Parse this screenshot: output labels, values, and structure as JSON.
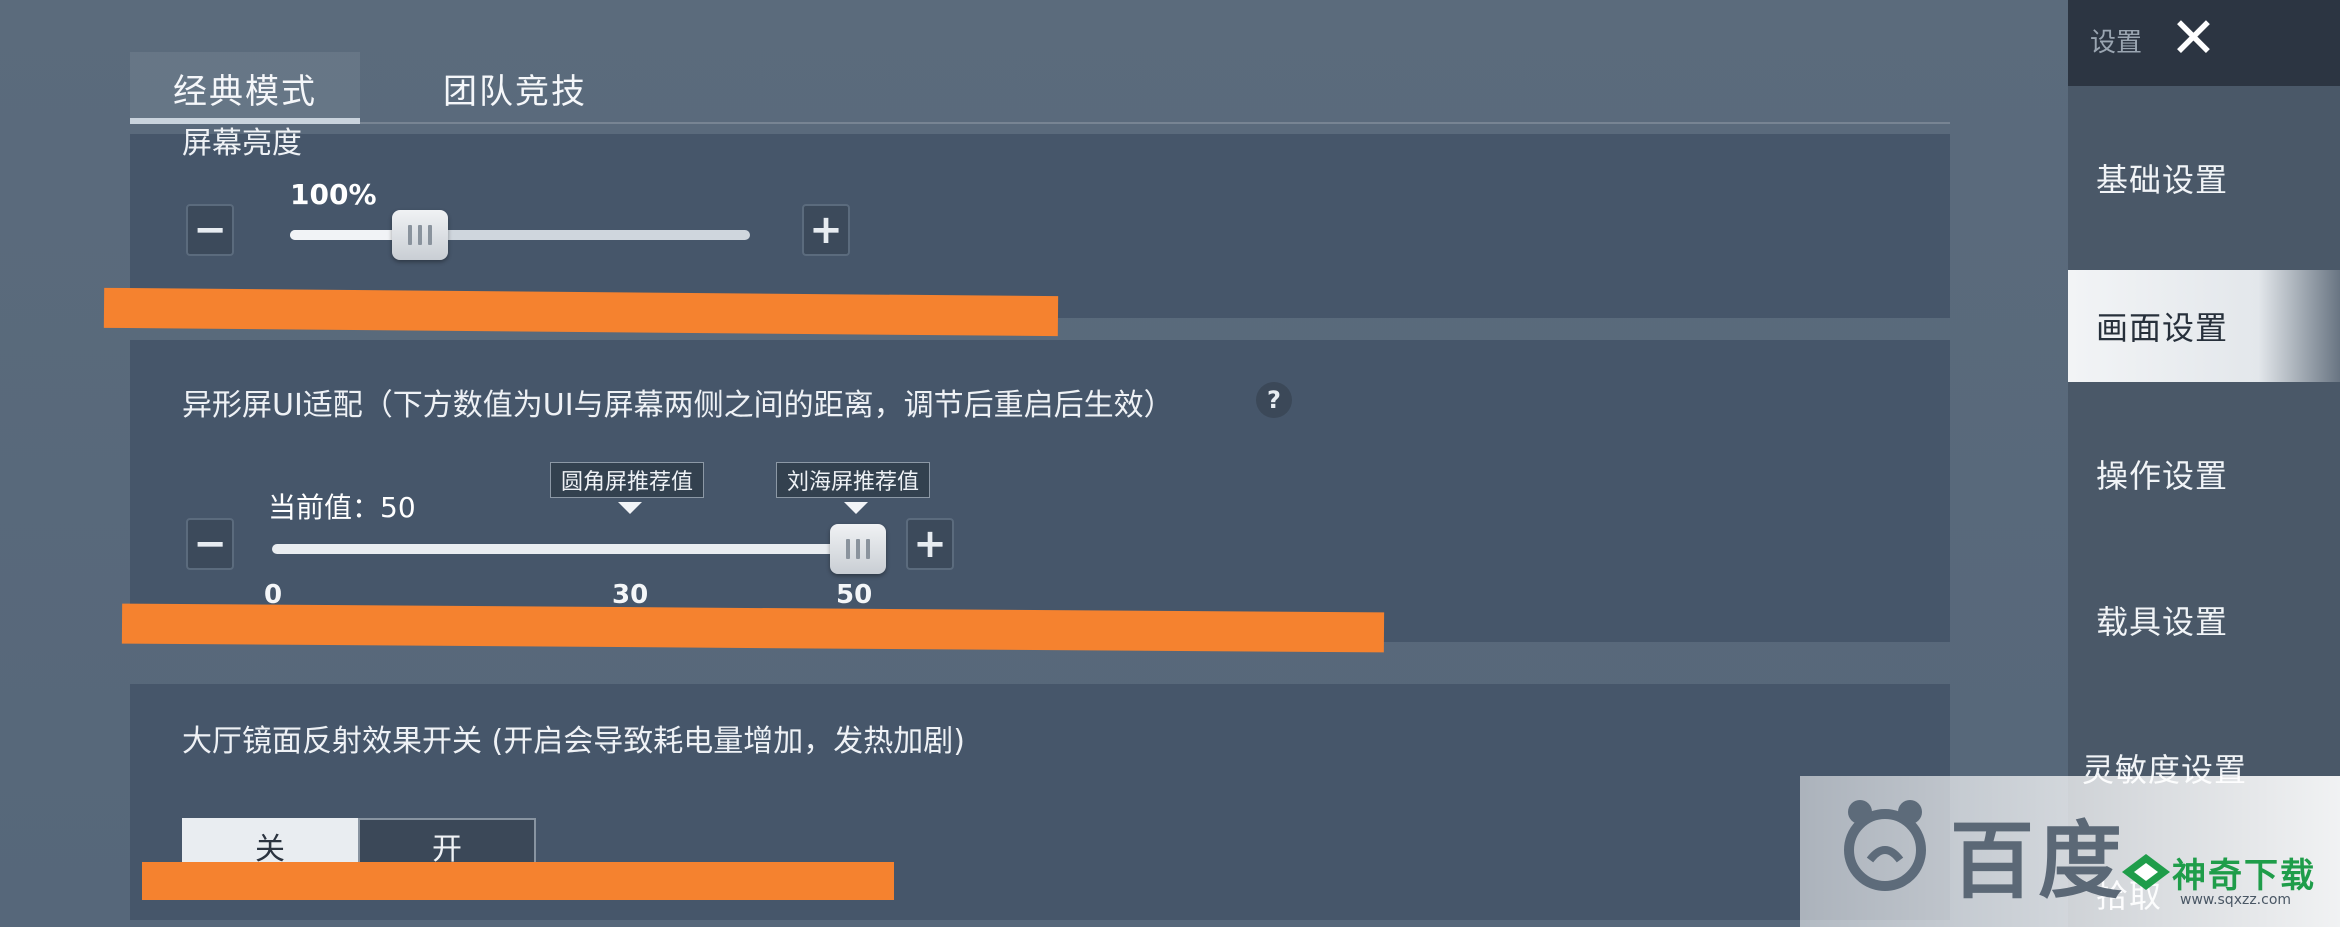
{
  "tabs": [
    {
      "label": "经典模式",
      "active": true
    },
    {
      "label": "团队竞技",
      "active": false
    }
  ],
  "brightness": {
    "title": "屏幕亮度",
    "value_label": "100%",
    "value_percent": 100,
    "minus": "−",
    "plus": "+"
  },
  "notch": {
    "title": "异形屏UI适配（下方数值为UI与屏幕两侧之间的距离，调节后重启后生效）",
    "help": "?",
    "current_label": "当前值：50",
    "current_value": 50,
    "callouts": [
      "圆角屏推荐值",
      "刘海屏推荐值"
    ],
    "ticks": [
      "0",
      "30",
      "50"
    ],
    "minus": "−",
    "plus": "+"
  },
  "reflection": {
    "title": "大厅镜面反射效果开关 (开启会导致耗电量增加，发热加剧)",
    "options": [
      "关",
      "开"
    ],
    "selected": "关"
  },
  "sidebar": {
    "header": "设置",
    "close": "✕",
    "items": [
      {
        "label": "基础设置",
        "active": false
      },
      {
        "label": "画面设置",
        "active": true
      },
      {
        "label": "操作设置",
        "active": false
      },
      {
        "label": "载具设置",
        "active": false
      },
      {
        "label": "灵敏度设置",
        "active": false
      },
      {
        "label": "拾取",
        "active": false
      }
    ]
  },
  "watermark": {
    "baidu_text": "百度",
    "site_name": "神奇下载",
    "site_url": "www.sqxzz.com"
  },
  "colors": {
    "redaction": "#f5822f",
    "panel": "#46566a",
    "background": "#5b6b7c"
  }
}
